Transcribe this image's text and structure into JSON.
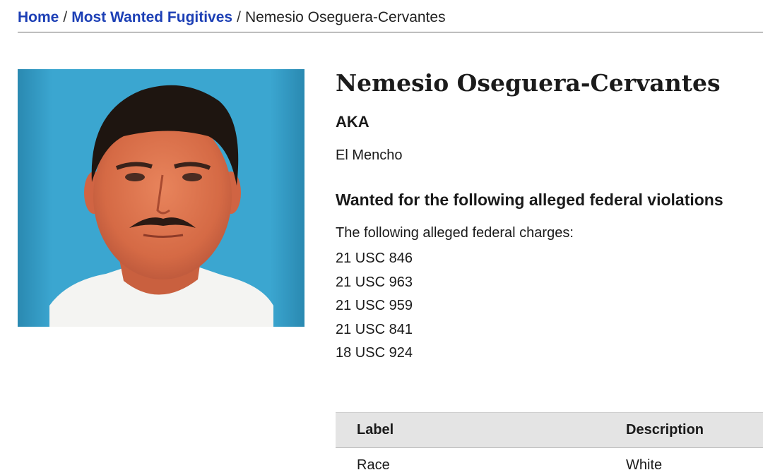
{
  "breadcrumb": {
    "home": "Home",
    "separator": "/",
    "section": "Most Wanted Fugitives",
    "current": "Nemesio Oseguera-Cervantes"
  },
  "profile": {
    "name": "Nemesio Oseguera-Cervantes",
    "aka_heading": "AKA",
    "aka_value": "El Mencho",
    "violations_heading": "Wanted for the following alleged federal violations",
    "charges_intro": "The following alleged federal charges:",
    "charges": [
      "21 USC 846",
      "21 USC 963",
      "21 USC 959",
      "21 USC 841",
      "18 USC 924"
    ]
  },
  "table": {
    "headers": [
      "Label",
      "Description"
    ],
    "rows": [
      [
        "Race",
        "White"
      ]
    ]
  },
  "colors": {
    "link": "#1c3fb5",
    "photo_background": "#3aa5cf",
    "table_header_bg": "#e4e4e4"
  }
}
